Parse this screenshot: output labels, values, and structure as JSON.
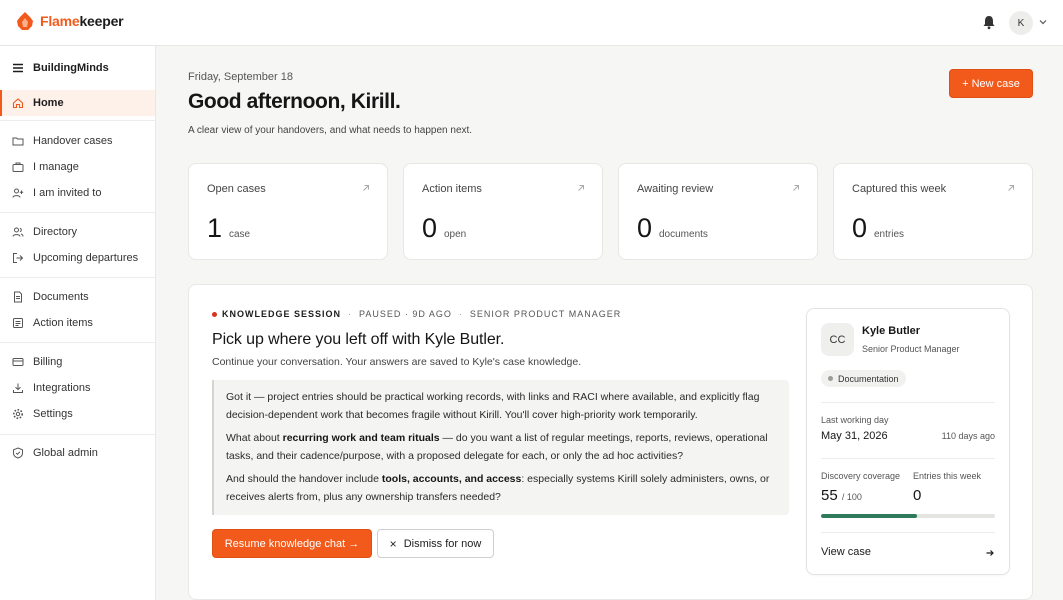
{
  "brand": {
    "name_accent": "Flame",
    "name_rest": "keeper",
    "accent_color": "#f25a1c"
  },
  "header": {
    "avatar_initial": "K",
    "icons": [
      "bell-icon",
      "chevron-down-icon"
    ]
  },
  "sidebar": {
    "workspace": "BuildingMinds",
    "items": [
      {
        "label": "Home",
        "icon": "home-icon",
        "active": true
      },
      {
        "label": "Handover cases",
        "icon": "folders-icon"
      },
      {
        "label": "I manage",
        "icon": "briefcase-icon"
      },
      {
        "label": "I am invited to",
        "icon": "user-plus-icon"
      },
      {
        "label": "Directory",
        "icon": "users-icon"
      },
      {
        "label": "Upcoming departures",
        "icon": "exit-icon"
      },
      {
        "label": "Documents",
        "icon": "document-icon"
      },
      {
        "label": "Action items",
        "icon": "checklist-icon"
      },
      {
        "label": "Billing",
        "icon": "card-icon"
      },
      {
        "label": "Integrations",
        "icon": "download-icon"
      },
      {
        "label": "Settings",
        "icon": "gear-icon"
      },
      {
        "label": "Global admin",
        "icon": "shield-icon"
      }
    ]
  },
  "main": {
    "date": "Friday, September 18",
    "greeting": "Good afternoon, Kirill.",
    "subtitle": "A clear view of your handovers, and what needs to happen next.",
    "new_case_label": "+ New case",
    "stats": [
      {
        "label": "Open cases",
        "value": "1",
        "unit": "case"
      },
      {
        "label": "Action items",
        "value": "0",
        "unit": "open"
      },
      {
        "label": "Awaiting review",
        "value": "0",
        "unit": "documents"
      },
      {
        "label": "Captured this week",
        "value": "0",
        "unit": "entries"
      }
    ]
  },
  "session": {
    "kicker": {
      "type": "KNOWLEDGE SESSION",
      "status": "PAUSED · 9D AGO",
      "role": "SENIOR PRODUCT MANAGER"
    },
    "title": "Pick up where you left off with Kyle Butler.",
    "subtitle": "Continue your conversation. Your answers are saved to Kyle's case knowledge.",
    "quote": {
      "p1": "Got it — project entries should be practical working records, with links and RACI where available, and explicitly flag decision-dependent work that becomes fragile without Kirill. You'll cover high-priority work temporarily.",
      "p2_pre": "What about ",
      "p2_bold": "recurring work and team rituals",
      "p2_post": " — do you want a list of regular meetings, reports, reviews, operational tasks, and their cadence/purpose, with a proposed delegate for each, or only the ad hoc activities?",
      "p3_pre": "And should the handover include ",
      "p3_bold": "tools, accounts, and access",
      "p3_post": ": especially systems Kirill solely administers, owns, or receives alerts from, plus any ownership transfers needed?"
    },
    "resume_label": "Resume knowledge chat →",
    "dismiss_label": "Dismiss for now",
    "dismiss_x": "×"
  },
  "person": {
    "initials": "CC",
    "name": "Kyle Butler",
    "role": "Senior Product Manager",
    "tag": "Documentation",
    "last_day_label": "Last working day",
    "last_day": "May 31, 2026",
    "days_ago": "110 days ago",
    "coverage_label": "Discovery coverage",
    "coverage_value": "55",
    "coverage_total": "/ 100",
    "coverage_fraction": 0.55,
    "coverage_color": "#2f7a5b",
    "entries_label": "Entries this week",
    "entries_value": "0",
    "view_case_label": "View case"
  }
}
